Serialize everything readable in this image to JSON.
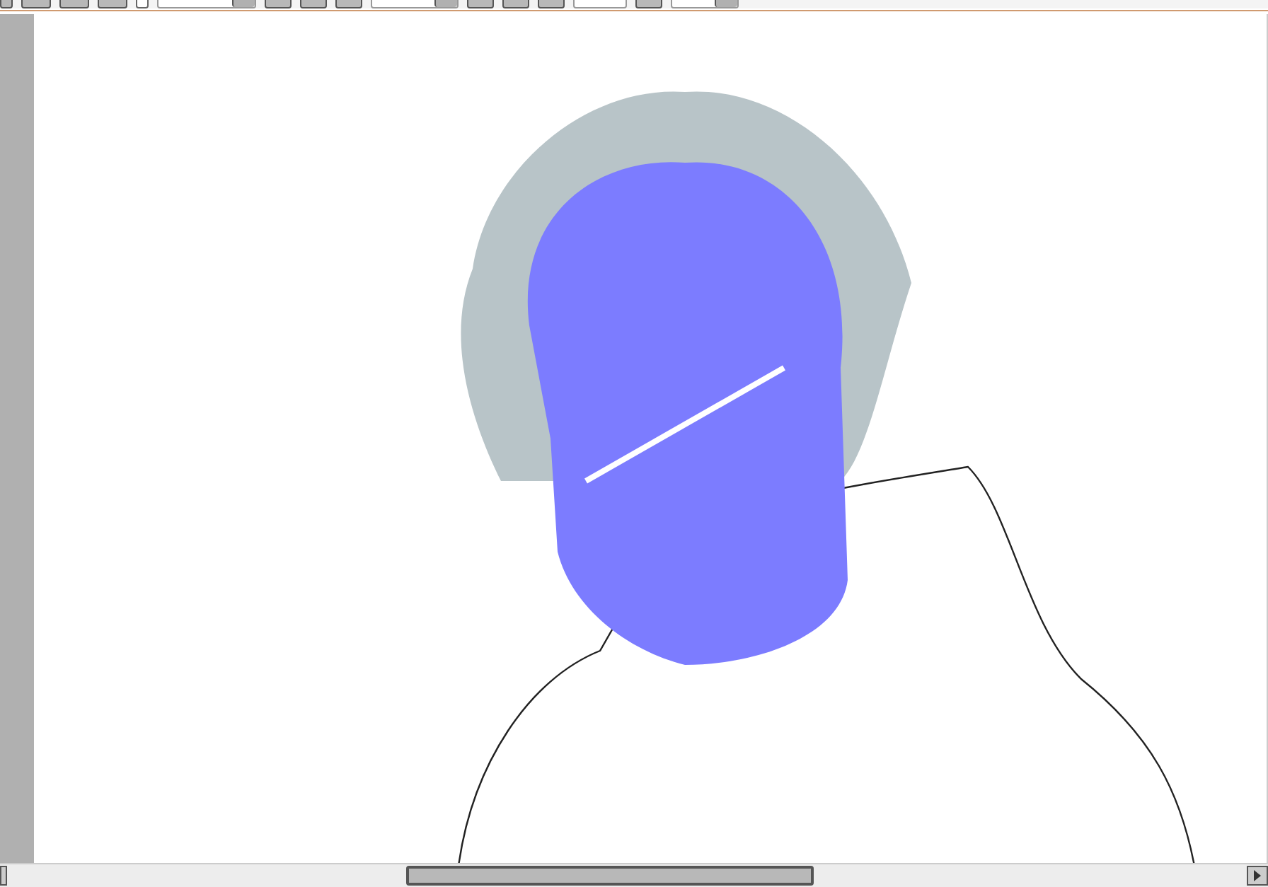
{
  "toolbar": {
    "items": [
      {
        "kind": "button"
      },
      {
        "kind": "button"
      },
      {
        "kind": "button"
      },
      {
        "kind": "button"
      },
      {
        "kind": "checkbox",
        "checked": false
      },
      {
        "kind": "dropdown"
      },
      {
        "kind": "button"
      },
      {
        "kind": "button"
      },
      {
        "kind": "button"
      },
      {
        "kind": "dropdown"
      },
      {
        "kind": "button"
      },
      {
        "kind": "button"
      },
      {
        "kind": "button"
      },
      {
        "kind": "field"
      },
      {
        "kind": "button"
      },
      {
        "kind": "dropdown"
      }
    ]
  }
}
